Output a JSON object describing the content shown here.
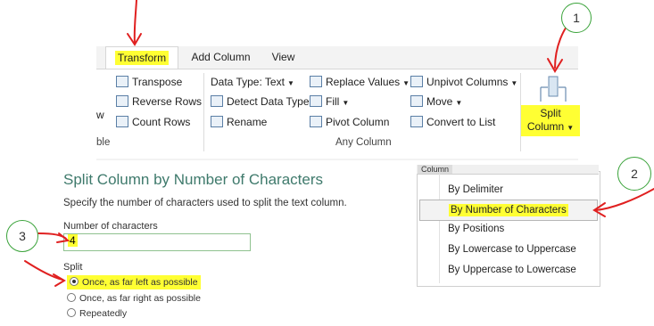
{
  "ribbon": {
    "tabs": [
      "Transform",
      "Add Column",
      "View"
    ],
    "left_partial": [
      "w",
      "ble"
    ],
    "col1": [
      "Transpose",
      "Reverse Rows",
      "Count Rows"
    ],
    "col2": [
      "Data Type: Text",
      "Detect Data Type",
      "Rename"
    ],
    "col3": [
      "Replace Values",
      "Fill",
      "Pivot Column"
    ],
    "col4": [
      "Unpivot Columns",
      "Move",
      "Convert to List"
    ],
    "group_label": "Any Column",
    "split_button": [
      "Split",
      "Column"
    ]
  },
  "dialog": {
    "title": "Split Column by Number of Characters",
    "description": "Specify the number of characters used to split the text column.",
    "num_label": "Number of characters",
    "num_value": "4",
    "split_label": "Split",
    "options": [
      "Once, as far left as possible",
      "Once, as far right as possible",
      "Repeatedly"
    ],
    "selected_option": 0
  },
  "menu": {
    "header": "Column",
    "items": [
      "By Delimiter",
      "By Number of Characters",
      "By Positions",
      "By Lowercase to Uppercase",
      "By Uppercase to Lowercase"
    ]
  },
  "annotations": [
    "1",
    "2",
    "3"
  ],
  "colors": {
    "highlight": "#ffff33",
    "annotation_red": "#e02020",
    "annotation_green": "#3aa33a",
    "title": "#3f7a6c"
  }
}
